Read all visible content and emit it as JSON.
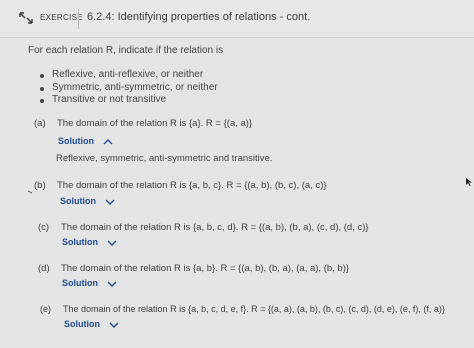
{
  "header": {
    "exercise_label": "EXERCISE",
    "title": "6.2.4: Identifying properties of relations - cont."
  },
  "intro": "For each relation R, indicate if the relation is",
  "bullets": [
    "Reflexive, anti-reflexive, or neither",
    "Symmetric, anti-symmetric, or neither",
    "Transitive or not transitive"
  ],
  "parts": [
    {
      "letter": "(a)",
      "text": "The domain of the relation R is {a}. R = {(a, a)}",
      "solution_label": "Solution",
      "expanded": true,
      "answer": "Reflexive, symmetric, anti-symmetric and transitive."
    },
    {
      "letter": "(b)",
      "text": "The domain of the relation R is {a, b, c}. R = {(a, b), (b, c), (a, c)}",
      "solution_label": "Solution",
      "expanded": false
    },
    {
      "letter": "(c)",
      "text": "The domain of the relation R is {a, b, c, d}. R = {(a, b), (b, a), (c, d), (d, c)}",
      "solution_label": "Solution",
      "expanded": false
    },
    {
      "letter": "(d)",
      "text": "The domain of the relation R is {a, b}. R = {(a, b), (b, a), (a, a), (b, b)}",
      "solution_label": "Solution",
      "expanded": false
    },
    {
      "letter": "(e)",
      "text": "The domain of the relation R is {a, b, c, d, e, f}. R = {(a, a), (a, b), (b, c), (c, d), (d, e), (e, f), (f, a)}",
      "solution_label": "Solution",
      "expanded": false
    }
  ],
  "colors": {
    "link": "#1f4e91",
    "background": "#e4e4e4",
    "text": "#444444"
  },
  "icons": {
    "header": "collapse-arrows-icon",
    "solution_expanded": "chevron-up-icon",
    "solution_collapsed": "chevron-down-icon"
  }
}
